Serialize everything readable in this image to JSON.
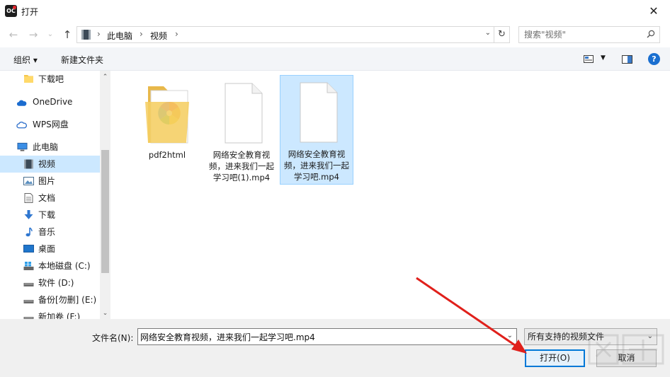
{
  "window": {
    "title": "打开",
    "app_icon_text": "OC",
    "close_glyph": "✕"
  },
  "address": {
    "breadcrumbs": [
      "此电脑",
      "视频"
    ],
    "search_placeholder": "搜索\"视频\""
  },
  "toolbar": {
    "organize_label": "组织 ▾",
    "new_folder_label": "新建文件夹",
    "help_glyph": "?"
  },
  "sidebar": {
    "items": [
      {
        "label": "下载吧",
        "icon": "folder-icon"
      },
      {
        "label": "OneDrive",
        "icon": "cloud-icon"
      },
      {
        "label": "WPS网盘",
        "icon": "wps-cloud-icon"
      },
      {
        "label": "此电脑",
        "icon": "computer-icon"
      },
      {
        "label": "视频",
        "icon": "video-icon",
        "selected": true
      },
      {
        "label": "图片",
        "icon": "picture-icon"
      },
      {
        "label": "文档",
        "icon": "document-icon"
      },
      {
        "label": "下载",
        "icon": "download-icon"
      },
      {
        "label": "音乐",
        "icon": "music-icon"
      },
      {
        "label": "桌面",
        "icon": "desktop-icon"
      },
      {
        "label": "本地磁盘 (C:)",
        "icon": "system-drive-icon"
      },
      {
        "label": "软件 (D:)",
        "icon": "drive-icon"
      },
      {
        "label": "备份[勿删] (E:)",
        "icon": "drive-icon"
      },
      {
        "label": "新加卷 (F:)",
        "icon": "drive-icon"
      }
    ]
  },
  "files": [
    {
      "name": "pdf2html",
      "type": "folder"
    },
    {
      "name": "网络安全教育视频，进来我们一起学习吧(1).mp4",
      "type": "file"
    },
    {
      "name": "网络安全教育视频，进来我们一起学习吧.mp4",
      "type": "file",
      "selected": true
    }
  ],
  "bottom": {
    "filename_label": "文件名(N):",
    "filename_value": "网络安全教育视频，进来我们一起学习吧.mp4",
    "filetype_value": "所有支持的视频文件",
    "open_label": "打开(O)",
    "cancel_label": "取消"
  },
  "colors": {
    "accent": "#0078d7",
    "selection": "#cce8ff",
    "annotation_arrow": "#e0201b"
  }
}
